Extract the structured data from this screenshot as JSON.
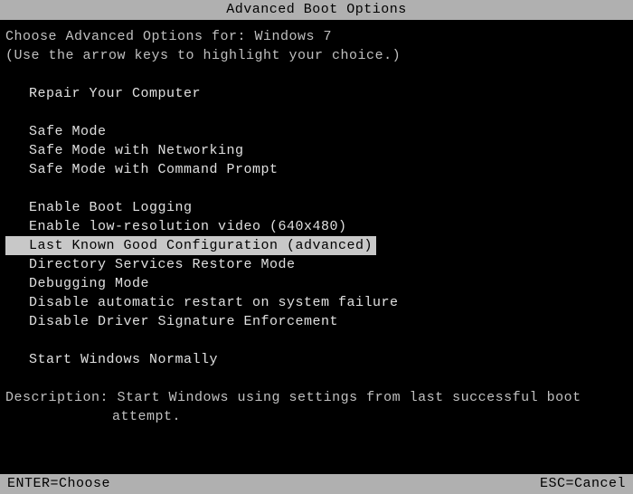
{
  "title": "Advanced Boot Options",
  "header": {
    "line1_prefix": "Choose Advanced Options for: ",
    "os_name": "Windows 7",
    "line2": "(Use the arrow keys to highlight your choice.)"
  },
  "options": {
    "group1": [
      "Repair Your Computer"
    ],
    "group2": [
      "Safe Mode",
      "Safe Mode with Networking",
      "Safe Mode with Command Prompt"
    ],
    "group3": [
      "Enable Boot Logging",
      "Enable low-resolution video (640x480)",
      "Last Known Good Configuration (advanced)",
      "Directory Services Restore Mode",
      "Debugging Mode",
      "Disable automatic restart on system failure",
      "Disable Driver Signature Enforcement"
    ],
    "group4": [
      "Start Windows Normally"
    ]
  },
  "selected_option": "Last Known Good Configuration (advanced)",
  "description": {
    "label": "Description: ",
    "text_line1": "Start Windows using settings from last successful boot",
    "text_line2": "attempt."
  },
  "footer": {
    "left": "ENTER=Choose",
    "right": "ESC=Cancel"
  }
}
